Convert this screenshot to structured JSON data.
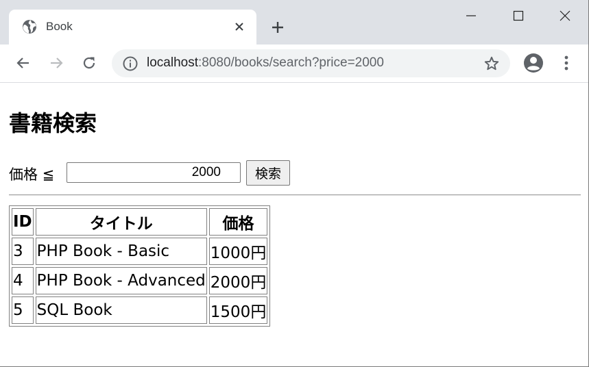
{
  "browser": {
    "tab_title": "Book",
    "url_host": "localhost",
    "url_path": ":8080/books/search?price=2000"
  },
  "page": {
    "heading": "書籍検索",
    "price_label": "価格 ≦",
    "price_value": "2000",
    "search_button": "検索"
  },
  "table": {
    "headers": [
      "ID",
      "タイトル",
      "価格"
    ],
    "rows": [
      [
        "3",
        "PHP Book - Basic",
        "1000円"
      ],
      [
        "4",
        "PHP Book - Advanced",
        "2000円"
      ],
      [
        "5",
        "SQL Book",
        "1500円"
      ]
    ]
  }
}
